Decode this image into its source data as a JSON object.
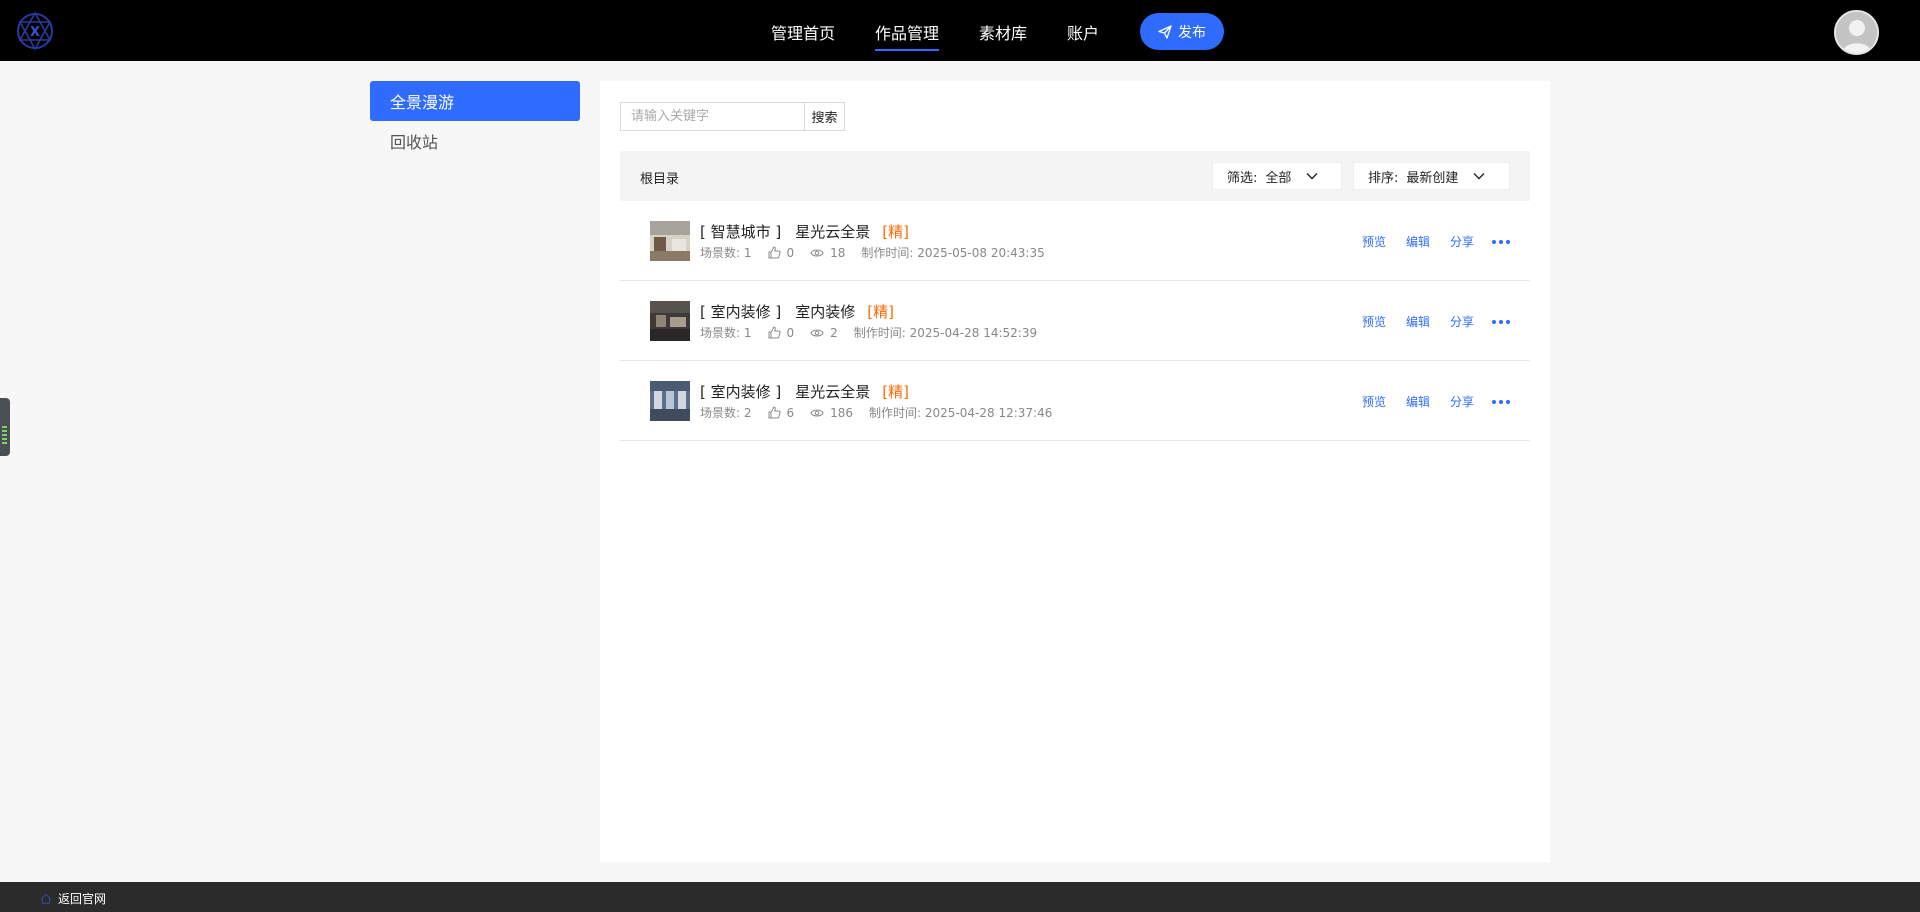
{
  "header": {
    "nav": [
      {
        "label": "管理首页",
        "active": false
      },
      {
        "label": "作品管理",
        "active": true
      },
      {
        "label": "素材库",
        "active": false
      },
      {
        "label": "账户",
        "active": false
      }
    ],
    "publish_label": "发布",
    "accent": "#2f6bff",
    "logo_icon": "x-star-logo",
    "avatar_icon": "user-avatar-icon"
  },
  "sidebar": {
    "items": [
      {
        "label": "全景漫游",
        "active": true
      },
      {
        "label": "回收站",
        "active": false
      }
    ]
  },
  "main": {
    "search": {
      "placeholder": "请输入关键字",
      "button_label": "搜索"
    },
    "directory_title": "根目录",
    "filter": {
      "label": "筛选:",
      "value": "全部"
    },
    "sort": {
      "label": "排序:",
      "value": "最新创建"
    },
    "works": [
      {
        "category": "[ 智慧城市 ]",
        "title": "星光云全景",
        "badge": "[精]",
        "scenes": "场景数: 1",
        "likes": "0",
        "views": "18",
        "created": "制作时间: 2025-05-08 20:43:35",
        "actions": {
          "preview": "预览",
          "edit": "编辑",
          "share": "分享"
        }
      },
      {
        "category": "[ 室内装修 ]",
        "title": "室内装修",
        "badge": "[精]",
        "scenes": "场景数: 1",
        "likes": "0",
        "views": "2",
        "created": "制作时间: 2025-04-28 14:52:39",
        "actions": {
          "preview": "预览",
          "edit": "编辑",
          "share": "分享"
        }
      },
      {
        "category": "[ 室内装修 ]",
        "title": "星光云全景",
        "badge": "[精]",
        "scenes": "场景数: 2",
        "likes": "6",
        "views": "186",
        "created": "制作时间: 2025-04-28 12:37:46",
        "actions": {
          "preview": "预览",
          "edit": "编辑",
          "share": "分享"
        }
      }
    ]
  },
  "footer": {
    "back_label": "返回官网"
  }
}
